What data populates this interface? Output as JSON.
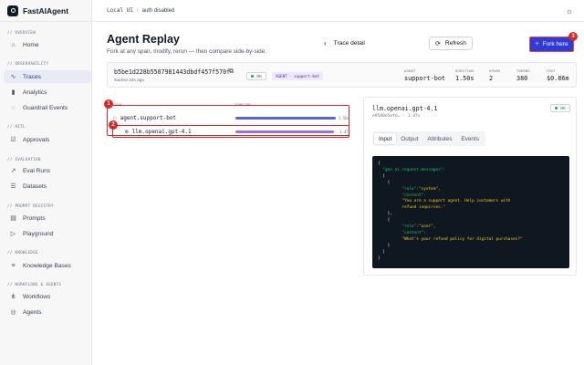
{
  "app": {
    "name": "FastAIAgent"
  },
  "topbar": {
    "env": "Local UI",
    "separator": "/",
    "auth": "auth disabled",
    "theme_icon": "sun-icon"
  },
  "sidebar": {
    "sections": [
      {
        "title": "// OVERVIEW",
        "items": [
          {
            "label": "Home",
            "icon": "home-icon"
          }
        ]
      },
      {
        "title": "// OBSERVABILITY",
        "items": [
          {
            "label": "Traces",
            "icon": "activity-icon",
            "active": true
          },
          {
            "label": "Analytics",
            "icon": "bar-chart-icon"
          },
          {
            "label": "Guardrail Events",
            "icon": "shield-icon"
          }
        ]
      },
      {
        "title": "// HITL",
        "items": [
          {
            "label": "Approvals",
            "icon": "check-square-icon"
          }
        ]
      },
      {
        "title": "// EVALUATION",
        "items": [
          {
            "label": "Eval Runs",
            "icon": "trend-icon"
          },
          {
            "label": "Datasets",
            "icon": "list-icon"
          }
        ]
      },
      {
        "title": "// PROMPT REGISTRY",
        "items": [
          {
            "label": "Prompts",
            "icon": "file-icon"
          },
          {
            "label": "Playground",
            "icon": "play-icon"
          }
        ]
      },
      {
        "title": "// KNOWLEDGE",
        "items": [
          {
            "label": "Knowledge Bases",
            "icon": "database-icon"
          }
        ]
      },
      {
        "title": "// WORKFLOWS & AGENTS",
        "items": [
          {
            "label": "Workflows",
            "icon": "workflow-icon"
          },
          {
            "label": "Agents",
            "icon": "bot-icon"
          }
        ]
      }
    ]
  },
  "header": {
    "title": "Agent Replay",
    "subtitle": "Fork at any span, modify, rerun — then compare side-by-side.",
    "back_label": "Trace detail",
    "refresh_label": "Refresh",
    "fork_label": "Fork here"
  },
  "trace": {
    "id": "b5be1d228b5507981443dbdf457f570f",
    "started": "started 32s ago",
    "status": "OK",
    "agent_badge": "AGENT · support-bot",
    "stats": [
      {
        "label": "AGENT",
        "value": "support-bot"
      },
      {
        "label": "DURATION",
        "value": "1.50s"
      },
      {
        "label": "SPANS",
        "value": "2"
      },
      {
        "label": "TOKENS",
        "value": "380"
      },
      {
        "label": "COST",
        "value": "$0.86m"
      }
    ]
  },
  "spans": {
    "headers": {
      "span": "SPAN",
      "timeline": "TIMELINE"
    },
    "rows": [
      {
        "name": "agent.support-bot",
        "duration": "1.50s",
        "fraction": 1.0,
        "color": "#5b64d3"
      },
      {
        "name": "llm.openai.gpt-4.1",
        "duration": "1.47s",
        "fraction": 0.98,
        "color": "#a56be0"
      }
    ]
  },
  "detail": {
    "title": "llm.openai.gpt-4.1",
    "subtitle": "e9580e5efd… · 1.47s",
    "status": "OK",
    "tabs": [
      "Input",
      "Output",
      "Attributes",
      "Events"
    ],
    "active_tab": "Input",
    "code": {
      "open": "{",
      "key": "\"gen_ai.request.messages\":",
      "arr_open": "[",
      "m1_open": "{",
      "m1_role_k": "\"role\":",
      "m1_role_v": "\"system\",",
      "m1_content_k": "\"content\":",
      "m1_content_v1": "\"You are a support agent. Help customers with",
      "m1_content_v2": "refund inquiries.\"",
      "m1_close": "},",
      "m2_open": "{",
      "m2_role_k": "\"role\":",
      "m2_role_v": "\"user\",",
      "m2_content_k": "\"content\":",
      "m2_content_v": "\"What's your refund policy for digital purchases?\"",
      "m2_close": "}",
      "arr_close": "]",
      "close": "}"
    }
  },
  "markers": [
    "1",
    "2",
    "3"
  ]
}
